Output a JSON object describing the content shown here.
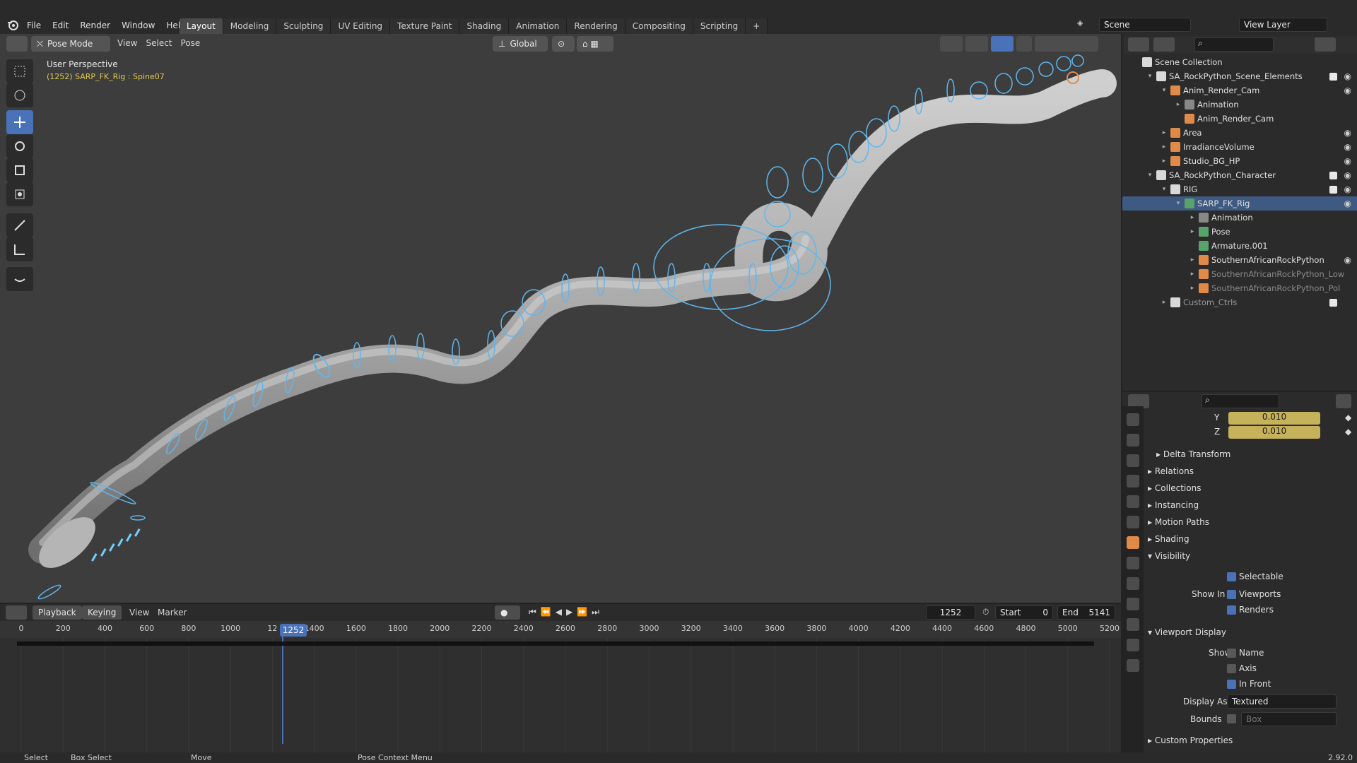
{
  "app": {
    "version": "2.92.0"
  },
  "menu": [
    "File",
    "Edit",
    "Render",
    "Window",
    "Help"
  ],
  "workspaces": [
    {
      "label": "Layout",
      "active": true
    },
    {
      "label": "Modeling",
      "active": false
    },
    {
      "label": "Sculpting",
      "active": false
    },
    {
      "label": "UV Editing",
      "active": false
    },
    {
      "label": "Texture Paint",
      "active": false
    },
    {
      "label": "Shading",
      "active": false
    },
    {
      "label": "Animation",
      "active": false
    },
    {
      "label": "Rendering",
      "active": false
    },
    {
      "label": "Compositing",
      "active": false
    },
    {
      "label": "Scripting",
      "active": false
    }
  ],
  "scene": {
    "name": "Scene",
    "view_layer": "View Layer"
  },
  "viewport": {
    "mode": "Pose Mode",
    "menus": [
      "View",
      "Select",
      "Pose"
    ],
    "transform_orientation": "Global",
    "overlay_title": "User Perspective",
    "overlay_info": "(1252) SARP_FK_Rig : Spine07"
  },
  "outliner": {
    "items": [
      {
        "label": "Scene Collection",
        "icon": "collection-icon",
        "color": "#e0e0e0",
        "eye": false,
        "check": false
      },
      {
        "label": "SA_RockPython_Scene_Elements",
        "icon": "collection-icon",
        "color": "#e0e0e0",
        "eye": true,
        "check": true
      },
      {
        "label": "Anim_Render_Cam",
        "icon": "camera-icon",
        "color": "#e0e0e0",
        "eye": true,
        "check": false
      },
      {
        "label": "Animation",
        "icon": "action-icon",
        "color": "#e0e0e0",
        "eye": false,
        "check": false
      },
      {
        "label": "Anim_Render_Cam",
        "icon": "camera-data-icon",
        "color": "#e0e0e0",
        "eye": false,
        "check": false
      },
      {
        "label": "Area",
        "icon": "light-icon",
        "color": "#e0e0e0",
        "eye": true,
        "check": false
      },
      {
        "label": "IrradianceVolume",
        "icon": "lightprobe-icon",
        "color": "#e0e0e0",
        "eye": true,
        "check": false
      },
      {
        "label": "Studio_BG_HP",
        "icon": "mesh-icon",
        "color": "#e0e0e0",
        "eye": true,
        "check": false
      },
      {
        "label": "SA_RockPython_Character",
        "icon": "collection-icon",
        "color": "#e0e0e0",
        "eye": true,
        "check": true
      },
      {
        "label": "RIG",
        "icon": "collection-icon",
        "color": "#e0e0e0",
        "eye": true,
        "check": true
      },
      {
        "label": "SARP_FK_Rig",
        "icon": "armature-icon",
        "color": "#e0e0e0",
        "eye": true,
        "check": false
      },
      {
        "label": "Animation",
        "icon": "action-icon",
        "color": "#e0e0e0",
        "eye": false,
        "check": false
      },
      {
        "label": "Pose",
        "icon": "pose-icon",
        "color": "#e0e0e0",
        "eye": false,
        "check": false
      },
      {
        "label": "Armature.001",
        "icon": "armature-data-icon",
        "color": "#e0e0e0",
        "eye": false,
        "check": false
      },
      {
        "label": "SouthernAfricanRockPython",
        "icon": "mesh-icon",
        "color": "#e0e0e0",
        "eye": true,
        "check": false
      },
      {
        "label": "SouthernAfricanRockPython_Low",
        "icon": "mesh-icon",
        "color": "#8a8a8a",
        "eye": false,
        "check": false
      },
      {
        "label": "SouthernAfricanRockPython_Pol",
        "icon": "mesh-icon",
        "color": "#8a8a8a",
        "eye": false,
        "check": false
      },
      {
        "label": "Custom_Ctrls",
        "icon": "collection-icon",
        "color": "#9a9a9a",
        "eye": false,
        "check": true
      }
    ]
  },
  "properties": {
    "scale_y": "0.010",
    "scale_z": "0.010",
    "axis_y": "Y",
    "axis_z": "Z",
    "panels": [
      "Delta Transform",
      "Relations",
      "Collections",
      "Instancing",
      "Motion Paths",
      "Shading",
      "Visibility"
    ],
    "selectable": "Selectable",
    "show_in": "Show In",
    "viewports": "Viewports",
    "renders": "Renders",
    "viewport_display": "Viewport Display",
    "show": "Show",
    "name": "Name",
    "axis": "Axis",
    "in_front": "In Front",
    "display_as_label": "Display As",
    "display_as": "Textured",
    "bounds_label": "Bounds",
    "bounds": "Box",
    "custom_props": "Custom Properties"
  },
  "timeline": {
    "menus": [
      "Playback",
      "Keying",
      "View",
      "Marker"
    ],
    "current_frame": "1252",
    "start_label": "Start",
    "start": "0",
    "end_label": "End",
    "end": "5141",
    "ticks": [
      "0",
      "200",
      "400",
      "600",
      "800",
      "1000",
      "12",
      "1400",
      "1600",
      "1800",
      "2000",
      "2200",
      "2400",
      "2600",
      "2800",
      "3000",
      "3200",
      "3400",
      "3600",
      "3800",
      "4000",
      "4200",
      "4400",
      "4600",
      "4800",
      "5000",
      "5200"
    ]
  },
  "statusbar": {
    "select": "Select",
    "box_select": "Box Select",
    "move": "Move",
    "context": "Pose Context Menu",
    "version": "2.92.0"
  },
  "colors": {
    "accent": "#4a72b8",
    "bone": "#5fb7ef",
    "highlight": "#3f5a82",
    "keyfield": "#c5b25a"
  }
}
